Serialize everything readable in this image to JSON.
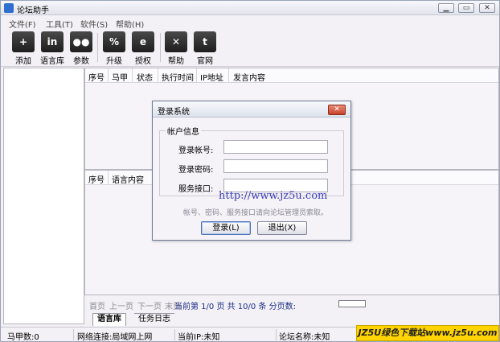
{
  "window": {
    "title": "论坛助手",
    "controls": [
      "▁",
      "▭",
      "✕"
    ]
  },
  "menu": [
    "文件(F)",
    "工具(T)",
    "软件(S)",
    "帮助(H)"
  ],
  "toolbar": [
    {
      "label": "添加",
      "icon": "add-user-icon",
      "glyph": "+"
    },
    {
      "label": "语言库",
      "icon": "linkedin-icon",
      "glyph": "in"
    },
    {
      "label": "参数",
      "icon": "flickr-icon",
      "glyph": "●●"
    },
    {
      "label": "升级",
      "icon": "upgrade-icon",
      "glyph": "%"
    },
    {
      "label": "授权",
      "icon": "license-icon",
      "glyph": "e"
    },
    {
      "label": "帮助",
      "icon": "xing-icon",
      "glyph": "✕"
    },
    {
      "label": "官网",
      "icon": "twitter-icon",
      "glyph": "t"
    }
  ],
  "grid_top": {
    "columns": [
      "序号",
      "马甲",
      "状态",
      "执行时间",
      "IP地址",
      "发言内容"
    ]
  },
  "grid_bottom": {
    "columns": [
      "序号",
      "语言内容"
    ]
  },
  "pager": {
    "first": "首页",
    "prev": "上一页",
    "next": "下一页",
    "last": "末页",
    "info": "当前第 1/0 页 共 10/0 条 分页数:"
  },
  "tabs": [
    "语言库",
    "任务日志"
  ],
  "status": {
    "vest_count": "马甲数:0",
    "network": "网络连接:局域网上网",
    "ip": "当前IP:未知",
    "forum": "论坛名称:未知"
  },
  "watermark": "JZ5U绿色下载站www.jz5u.com",
  "dialog": {
    "title": "登录系统",
    "group": "帐户信息",
    "account_label": "登录帐号:",
    "password_label": "登录密码:",
    "server_label": "服务接口:",
    "account_value": "",
    "password_value": "",
    "server_value": "",
    "url_overlay": "http://www.jz5u.com",
    "hint": "帐号、密码、服务接口请向论坛管理员索取。",
    "login_button": "登录(L)",
    "exit_button": "退出(X)"
  }
}
